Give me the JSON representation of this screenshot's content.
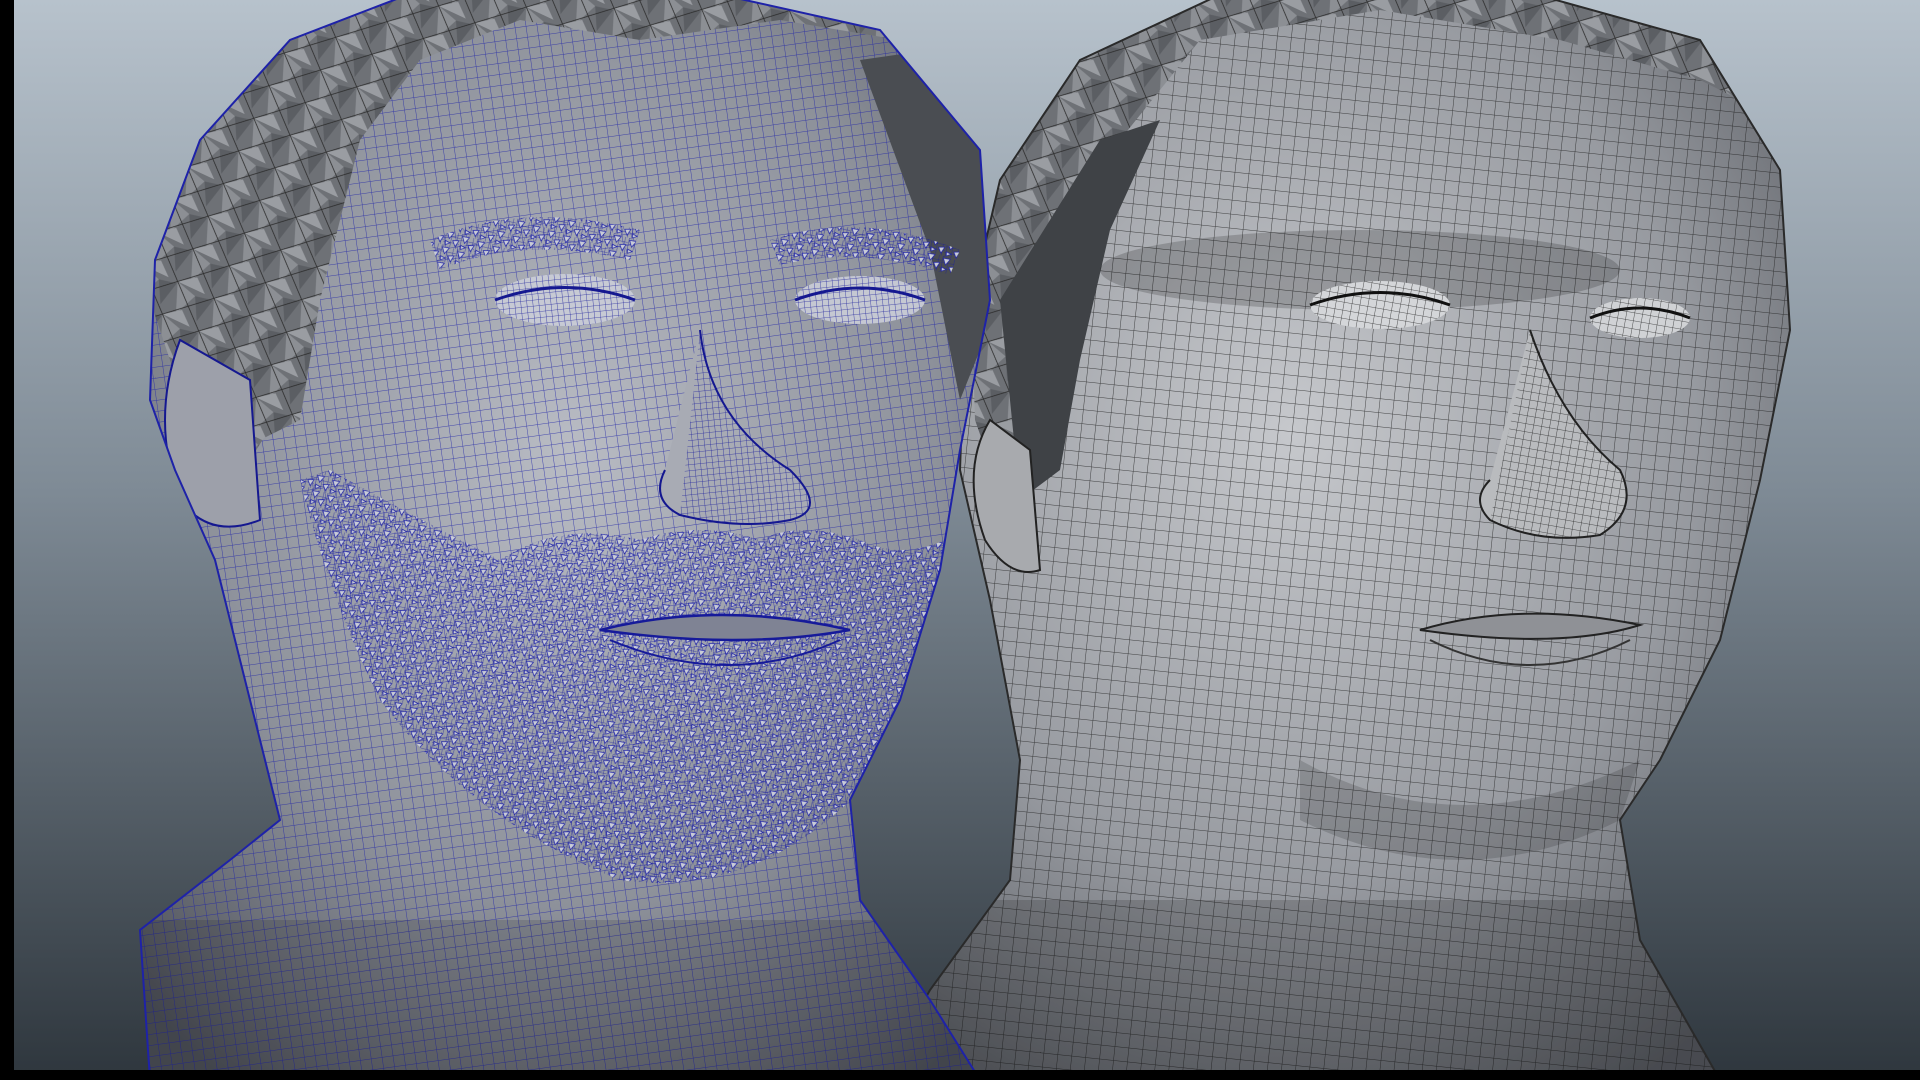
{
  "viewport": {
    "background_top": "#b7c2cc",
    "background_mid": "#7f8b96",
    "background_bottom": "#2e363d"
  },
  "models": [
    {
      "name": "bearded-head-model",
      "wireframe_color": "#1e22a8",
      "shading": "#9a9ea4"
    },
    {
      "name": "clean-shaven-head-model",
      "wireframe_color": "#1a1a1a",
      "shading": "#9c9c9c"
    }
  ]
}
